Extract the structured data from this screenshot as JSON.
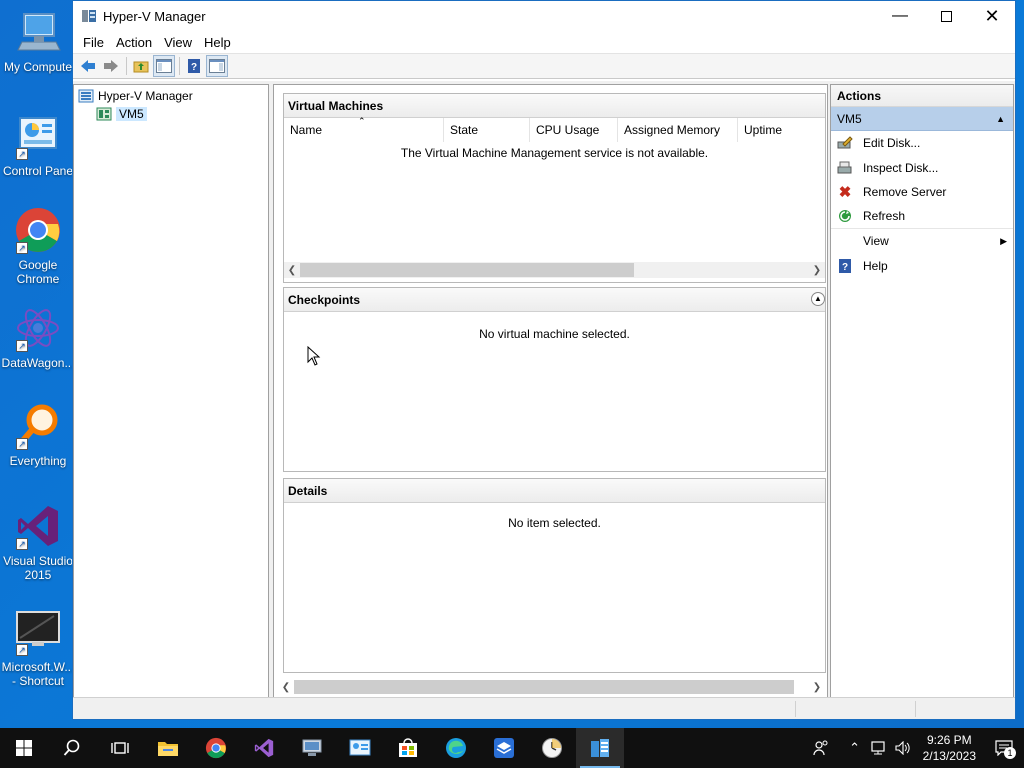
{
  "desktop": {
    "icons": [
      {
        "label": "My Compute",
        "name": "my-computer"
      },
      {
        "label": "Control Pane",
        "name": "control-panel"
      },
      {
        "label": "Google Chrome",
        "name": "google-chrome"
      },
      {
        "label": "DataWagon...",
        "name": "datawagon"
      },
      {
        "label": "Everything",
        "name": "everything"
      },
      {
        "label": "Visual Studio 2015",
        "name": "visual-studio-2015"
      },
      {
        "label": "Microsoft.W... - Shortcut",
        "name": "microsoft-w-shortcut"
      }
    ]
  },
  "window": {
    "title": "Hyper-V Manager",
    "menu": [
      "File",
      "Action",
      "View",
      "Help"
    ]
  },
  "tree": {
    "root": "Hyper-V Manager",
    "child": "VM5"
  },
  "vm_section": {
    "title": "Virtual Machines",
    "columns": [
      "Name",
      "State",
      "CPU Usage",
      "Assigned Memory",
      "Uptime"
    ],
    "message": "The Virtual Machine Management service is not available."
  },
  "checkpoints_section": {
    "title": "Checkpoints",
    "message": "No virtual machine selected."
  },
  "details_section": {
    "title": "Details",
    "message": "No item selected."
  },
  "actions": {
    "title": "Actions",
    "group": "VM5",
    "items": [
      {
        "label": "Edit Disk...",
        "icon": "edit-disk-icon"
      },
      {
        "label": "Inspect Disk...",
        "icon": "inspect-disk-icon"
      },
      {
        "label": "Remove Server",
        "icon": "remove-icon"
      },
      {
        "label": "Refresh",
        "icon": "refresh-icon"
      },
      {
        "label": "View",
        "icon": ""
      },
      {
        "label": "Help",
        "icon": "help-icon"
      }
    ]
  },
  "taskbar": {
    "time": "9:26 PM",
    "date": "2/13/2023",
    "notification_count": "1"
  }
}
